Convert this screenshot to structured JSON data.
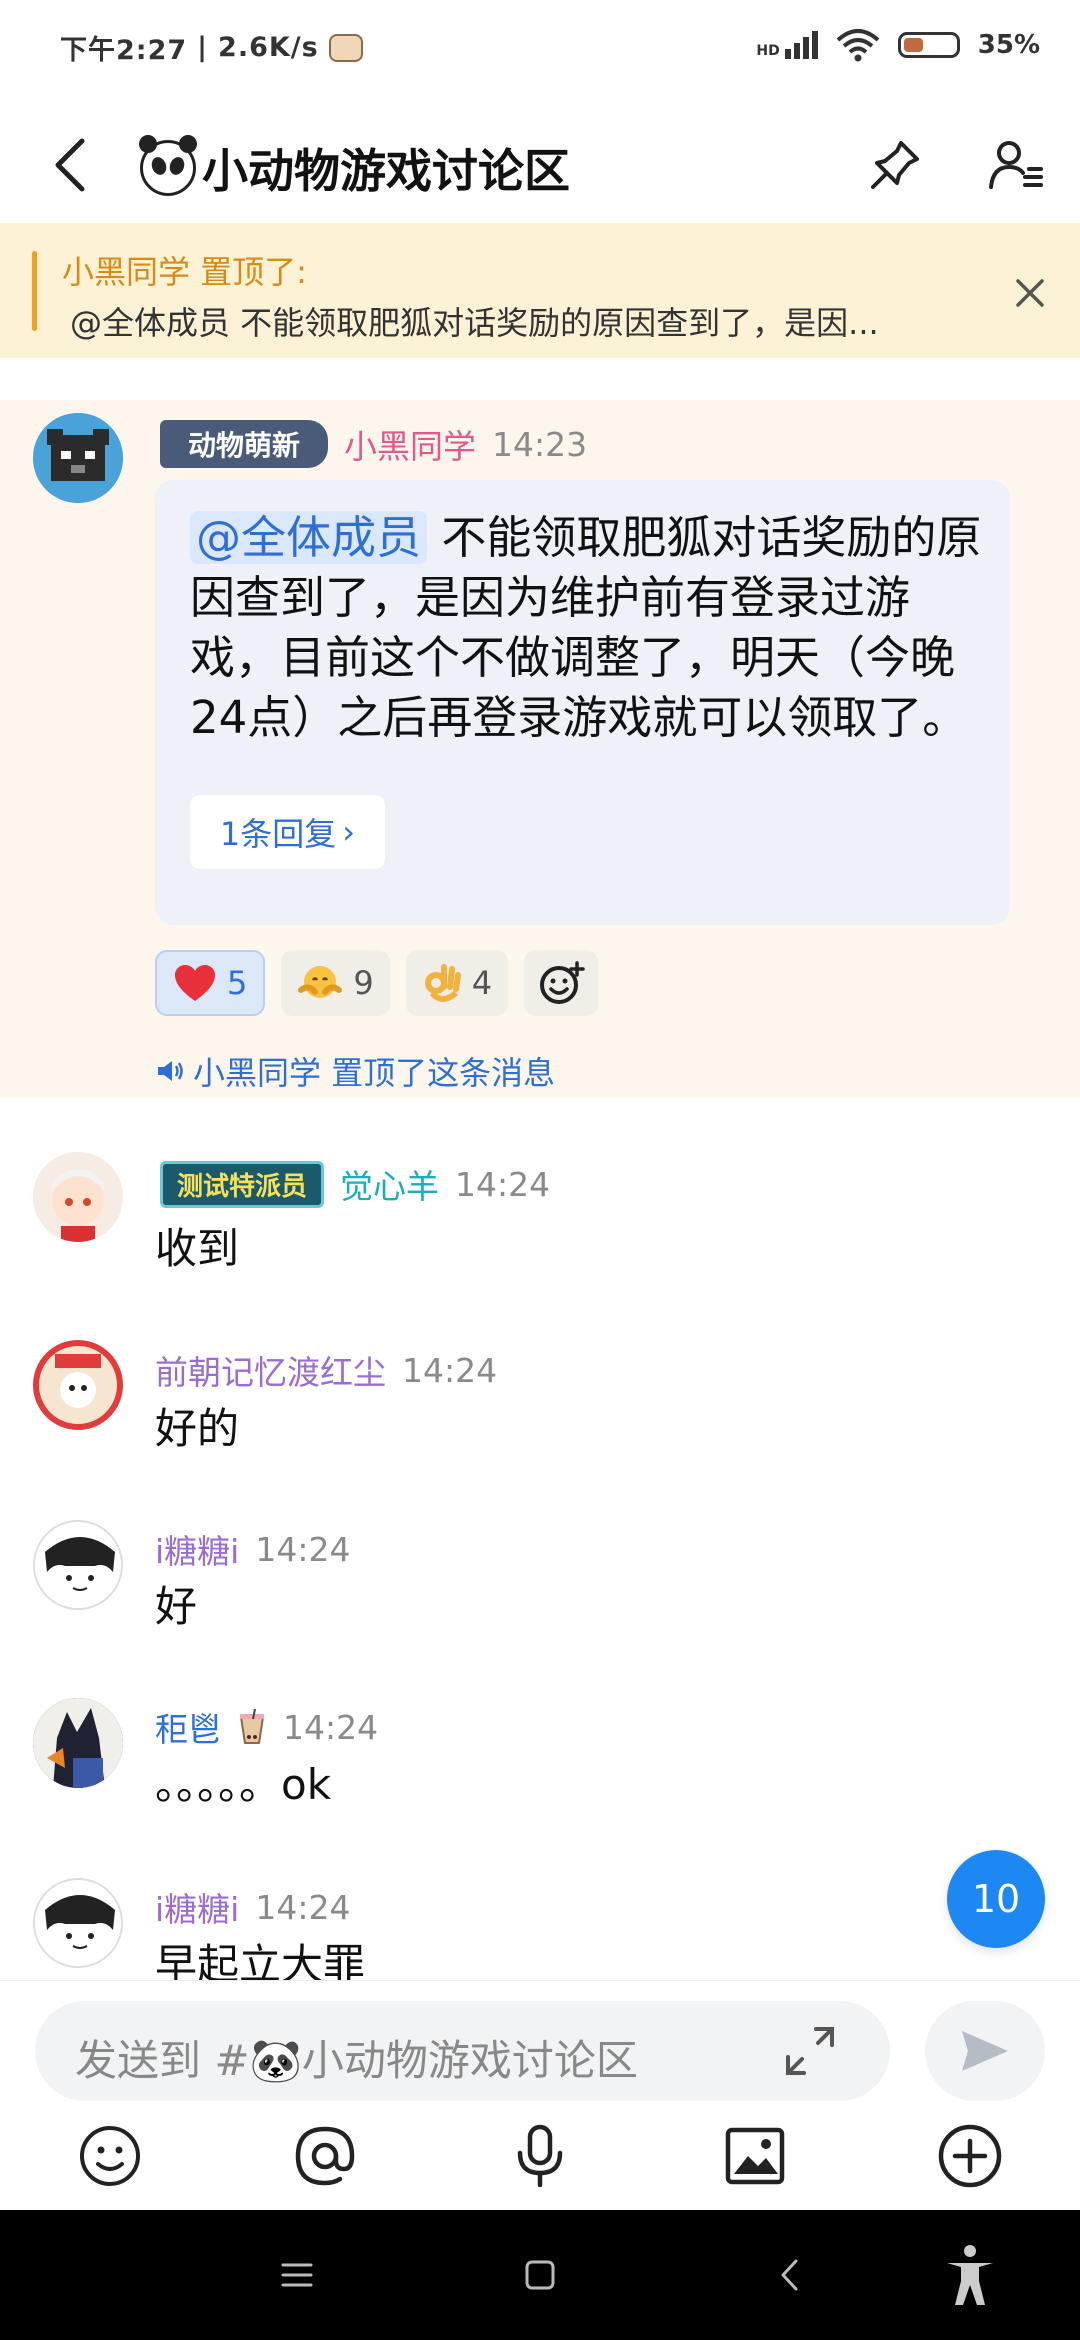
{
  "status_bar": {
    "time": "下午2:27",
    "speed": "2.6K/s",
    "network": "HD",
    "battery": "35%",
    "battery_level": 0.35
  },
  "header": {
    "title": "小动物游戏讨论区"
  },
  "pinned_banner": {
    "who": "小黑同学 置顶了:",
    "message": "@全体成员 不能领取肥狐对话奖励的原因查到了，是因..."
  },
  "pinned_message": {
    "badge": "动物萌新",
    "author": "小黑同学",
    "author_color": "#e05a8c",
    "time": "14:23",
    "mention": "@全体成员",
    "text": " 不能领取肥狐对话奖励的原因查到了，是因为维护前有登录过游戏，目前这个不做调整了，明天（今晚24点）之后再登录游戏就可以领取了。",
    "reply_label": "1条回复",
    "reactions": [
      {
        "emoji": "heart",
        "count": "5",
        "active": true
      },
      {
        "emoji": "hug",
        "count": "9",
        "active": false
      },
      {
        "emoji": "ok-hand",
        "count": "4",
        "active": false
      }
    ],
    "pin_notice": "小黑同学 置顶了这条消息"
  },
  "messages": [
    {
      "author": "觉心羊",
      "author_color": "#1aaeb8",
      "badge": "测试特派员",
      "time": "14:24",
      "text": "收到"
    },
    {
      "author": "前朝记忆渡红尘",
      "author_color": "#9b6cd1",
      "time": "14:24",
      "text": "好的"
    },
    {
      "author": "i糖糖i",
      "author_color": "#9b6cd1",
      "time": "14:24",
      "text": "好"
    },
    {
      "author": "秬鬯",
      "author_color": "#2d6fd6",
      "time": "14:24",
      "text": "。。。。。ok"
    },
    {
      "author": "i糖糖i",
      "author_color": "#9b6cd1",
      "time": "14:24",
      "text": "早起立大罪"
    }
  ],
  "unread_count": "10",
  "input": {
    "placeholder": "发送到 #🐼小动物游戏讨论区"
  },
  "colors": {
    "accent": "#1e88f2",
    "pinned_bg": "#fdf1d6",
    "highlight_bg": "#fdf6ec"
  }
}
